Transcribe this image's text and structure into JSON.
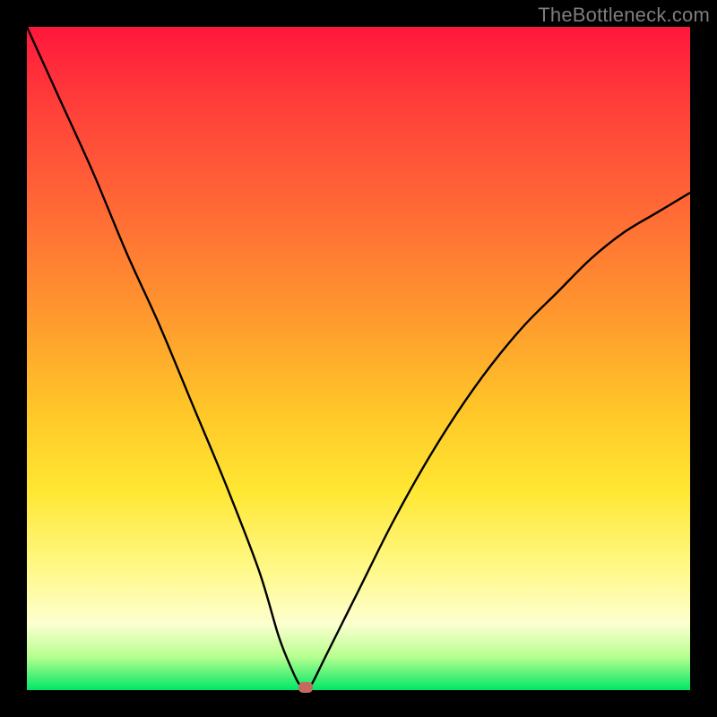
{
  "watermark": "TheBottleneck.com",
  "chart_data": {
    "type": "line",
    "title": "",
    "xlabel": "",
    "ylabel": "",
    "xlim": [
      0,
      100
    ],
    "ylim": [
      0,
      100
    ],
    "grid": false,
    "series": [
      {
        "name": "curve",
        "x": [
          0,
          5,
          10,
          15,
          20,
          25,
          30,
          35,
          38,
          40,
          41,
          42,
          43,
          45,
          50,
          55,
          60,
          65,
          70,
          75,
          80,
          85,
          90,
          95,
          100
        ],
        "values": [
          100,
          89,
          78,
          66,
          55,
          43,
          31,
          18,
          8,
          3,
          1,
          0,
          1,
          5,
          15,
          25,
          34,
          42,
          49,
          55,
          60,
          65,
          69,
          72,
          75
        ]
      }
    ],
    "marker": {
      "x": 42,
      "y": 0,
      "color": "#c66a60"
    },
    "background_gradient": {
      "direction": "vertical",
      "stops": [
        {
          "pos": 0.0,
          "color": "#ff173b"
        },
        {
          "pos": 0.28,
          "color": "#ff6b35"
        },
        {
          "pos": 0.58,
          "color": "#ffc728"
        },
        {
          "pos": 0.82,
          "color": "#fff98a"
        },
        {
          "pos": 1.0,
          "color": "#00e765"
        }
      ]
    }
  }
}
